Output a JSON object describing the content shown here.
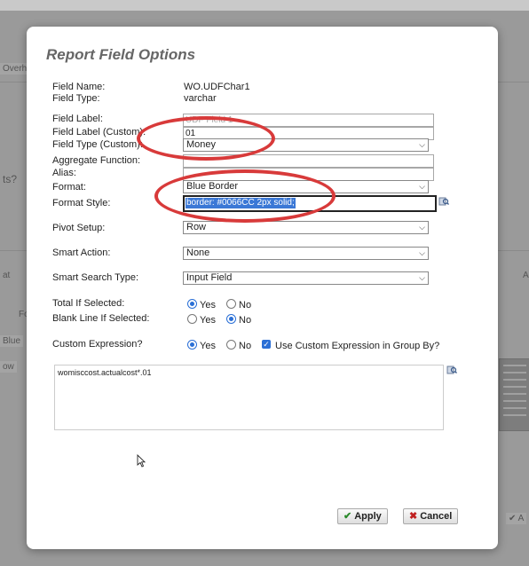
{
  "background": {
    "fragments": [
      "Overh",
      "ts?",
      "at",
      "Fo",
      "Blue",
      "ow",
      "A",
      "✔ A"
    ]
  },
  "dialog": {
    "title": "Report Field Options",
    "fields": {
      "field_name_label": "Field Name:",
      "field_name_value": "WO.UDFChar1",
      "field_type_label": "Field Type:",
      "field_type_value": "varchar",
      "field_label_label": "Field Label:",
      "field_label_value": "UDF Field 1",
      "field_label_custom_label": "Field Label (Custom):",
      "field_label_custom_value": "01",
      "field_type_custom_label": "Field Type (Custom):",
      "field_type_custom_value": "Money",
      "aggregate_label": "Aggregate Function:",
      "alias_label": "Alias:",
      "format_label": "Format:",
      "format_value": "Blue Border",
      "format_style_label": "Format Style:",
      "format_style_value": "border: #0066CC 2px solid;",
      "pivot_label": "Pivot Setup:",
      "pivot_value": "Row",
      "smart_action_label": "Smart Action:",
      "smart_action_value": "None",
      "smart_search_label": "Smart Search Type:",
      "smart_search_value": "Input Field",
      "total_label": "Total If Selected:",
      "blank_line_label": "Blank Line If Selected:",
      "custom_expr_label": "Custom Expression?",
      "custom_expr_group_by_label": "Use Custom Expression in Group By?",
      "yes": "Yes",
      "no": "No",
      "expression_text": "womisccost.actualcost*.01"
    },
    "state": {
      "total_if_selected": "Yes",
      "blank_line_if_selected": "No",
      "custom_expression": "Yes",
      "use_in_group_by": true
    },
    "buttons": {
      "apply": "Apply",
      "cancel": "Cancel"
    }
  },
  "colors": {
    "accent": "#2a6fd6",
    "annotation_red": "#d83a3a",
    "selection": "#3b78d6"
  }
}
